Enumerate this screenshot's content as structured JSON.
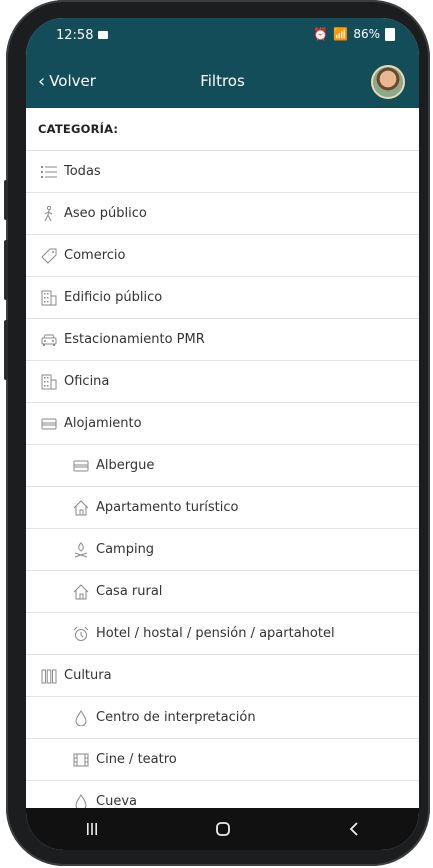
{
  "status": {
    "time": "12:58",
    "battery": "86%"
  },
  "header": {
    "back_label": "Volver",
    "title": "Filtros"
  },
  "category_heading": "CATEGORÍA:",
  "items": [
    {
      "label": "Todas",
      "icon": "list-icon",
      "level": 0
    },
    {
      "label": "Aseo público",
      "icon": "person-walking-icon",
      "level": 0
    },
    {
      "label": "Comercio",
      "icon": "tag-icon",
      "level": 0
    },
    {
      "label": "Edificio público",
      "icon": "building-icon",
      "level": 0
    },
    {
      "label": "Estacionamiento PMR",
      "icon": "car-icon",
      "level": 0
    },
    {
      "label": "Oficina",
      "icon": "building-icon",
      "level": 0
    },
    {
      "label": "Alojamiento",
      "icon": "bed-icon",
      "level": 0
    },
    {
      "label": "Albergue",
      "icon": "bed-icon",
      "level": 1
    },
    {
      "label": "Apartamento turístico",
      "icon": "house-icon",
      "level": 1
    },
    {
      "label": "Camping",
      "icon": "campfire-icon",
      "level": 1
    },
    {
      "label": "Casa rural",
      "icon": "house-icon",
      "level": 1
    },
    {
      "label": "Hotel / hostal / pensión / apartahotel",
      "icon": "alarm-clock-icon",
      "level": 1
    },
    {
      "label": "Cultura",
      "icon": "columns-icon",
      "level": 0
    },
    {
      "label": "Centro de interpretación",
      "icon": "drop-icon",
      "level": 1
    },
    {
      "label": "Cine / teatro",
      "icon": "film-icon",
      "level": 1
    },
    {
      "label": "Cueva",
      "icon": "drop-icon",
      "level": 1
    }
  ],
  "colors": {
    "header": "#134d5a",
    "navbar": "#111111"
  }
}
